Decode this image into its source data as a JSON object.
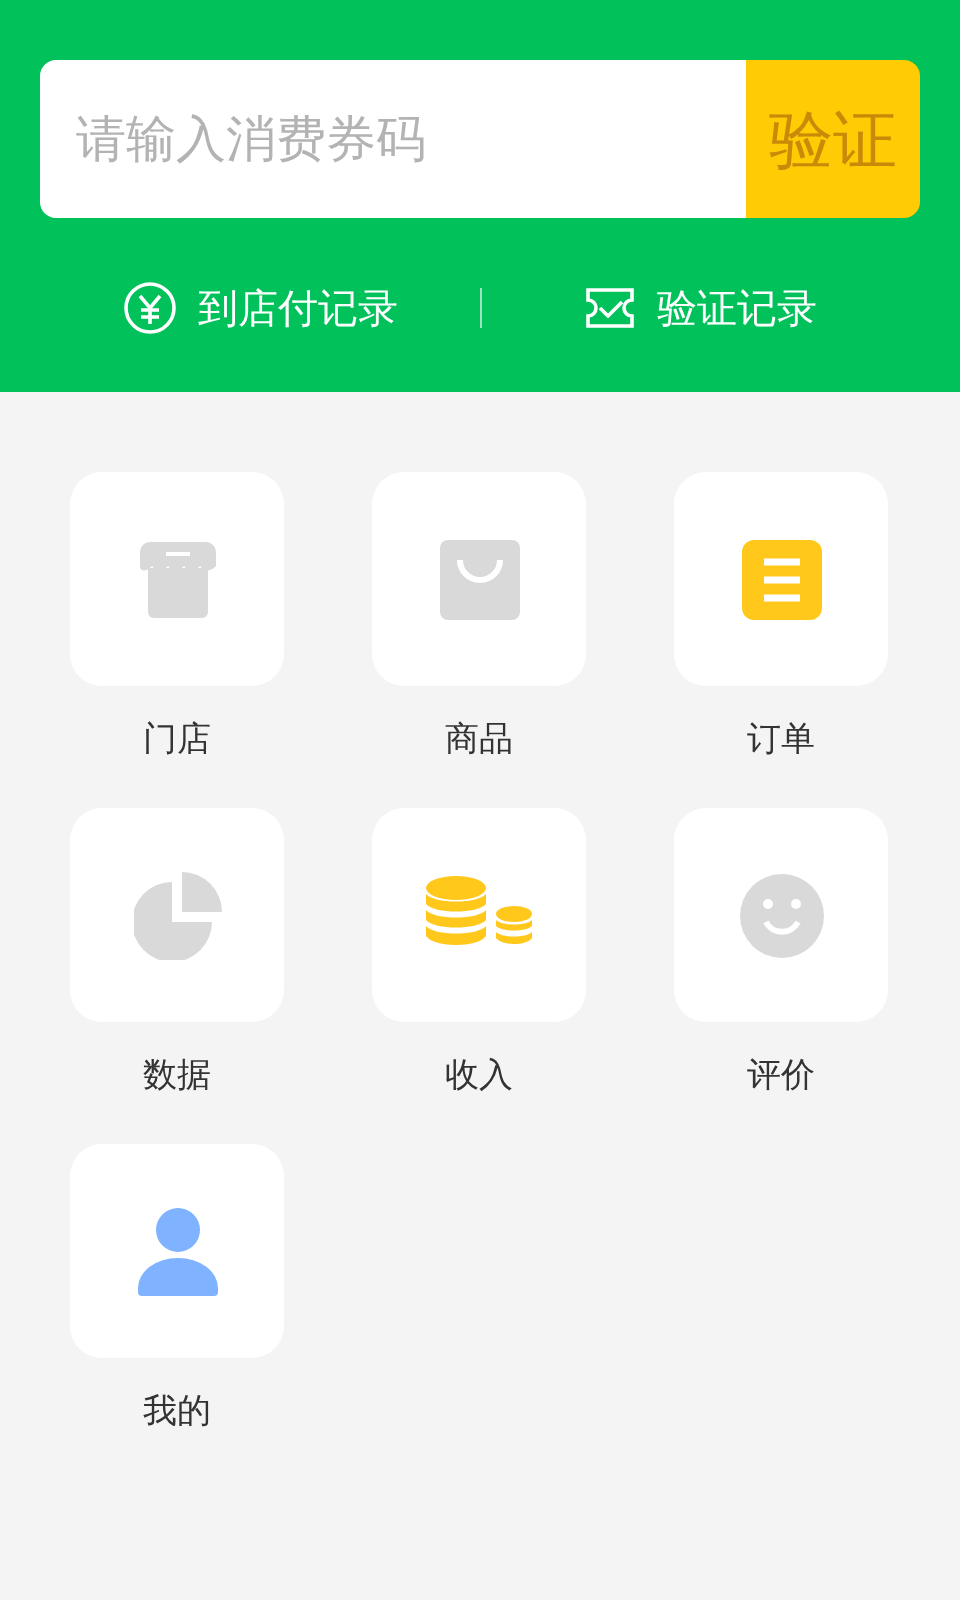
{
  "search": {
    "placeholder": "请输入消费券码",
    "button": "验证"
  },
  "links": [
    {
      "kind": "yen",
      "label": "到店付记录"
    },
    {
      "kind": "ticket",
      "label": "验证记录"
    }
  ],
  "tiles": [
    {
      "kind": "store",
      "label": "门店",
      "color": "#d9d9d9"
    },
    {
      "kind": "bag",
      "label": "商品",
      "color": "#d9d9d9"
    },
    {
      "kind": "list",
      "label": "订单",
      "color": "#ffc81a"
    },
    {
      "kind": "pie",
      "label": "数据",
      "color": "#d9d9d9"
    },
    {
      "kind": "coins",
      "label": "收入",
      "color": "#ffc81a"
    },
    {
      "kind": "smile",
      "label": "评价",
      "color": "#d9d9d9"
    },
    {
      "kind": "person",
      "label": "我的",
      "color": "#7fb2ff"
    }
  ]
}
